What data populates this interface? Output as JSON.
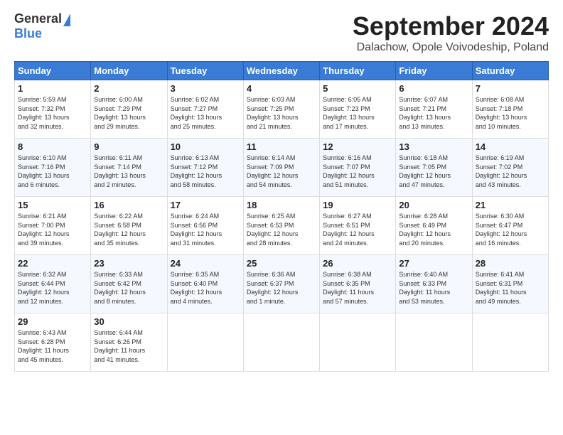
{
  "logo": {
    "general": "General",
    "blue": "Blue"
  },
  "title": "September 2024",
  "location": "Dalachow, Opole Voivodeship, Poland",
  "headers": [
    "Sunday",
    "Monday",
    "Tuesday",
    "Wednesday",
    "Thursday",
    "Friday",
    "Saturday"
  ],
  "weeks": [
    [
      {
        "day": "1",
        "lines": [
          "Sunrise: 5:59 AM",
          "Sunset: 7:32 PM",
          "Daylight: 13 hours",
          "and 32 minutes."
        ]
      },
      {
        "day": "2",
        "lines": [
          "Sunrise: 6:00 AM",
          "Sunset: 7:29 PM",
          "Daylight: 13 hours",
          "and 29 minutes."
        ]
      },
      {
        "day": "3",
        "lines": [
          "Sunrise: 6:02 AM",
          "Sunset: 7:27 PM",
          "Daylight: 13 hours",
          "and 25 minutes."
        ]
      },
      {
        "day": "4",
        "lines": [
          "Sunrise: 6:03 AM",
          "Sunset: 7:25 PM",
          "Daylight: 13 hours",
          "and 21 minutes."
        ]
      },
      {
        "day": "5",
        "lines": [
          "Sunrise: 6:05 AM",
          "Sunset: 7:23 PM",
          "Daylight: 13 hours",
          "and 17 minutes."
        ]
      },
      {
        "day": "6",
        "lines": [
          "Sunrise: 6:07 AM",
          "Sunset: 7:21 PM",
          "Daylight: 13 hours",
          "and 13 minutes."
        ]
      },
      {
        "day": "7",
        "lines": [
          "Sunrise: 6:08 AM",
          "Sunset: 7:18 PM",
          "Daylight: 13 hours",
          "and 10 minutes."
        ]
      }
    ],
    [
      {
        "day": "8",
        "lines": [
          "Sunrise: 6:10 AM",
          "Sunset: 7:16 PM",
          "Daylight: 13 hours",
          "and 6 minutes."
        ]
      },
      {
        "day": "9",
        "lines": [
          "Sunrise: 6:11 AM",
          "Sunset: 7:14 PM",
          "Daylight: 13 hours",
          "and 2 minutes."
        ]
      },
      {
        "day": "10",
        "lines": [
          "Sunrise: 6:13 AM",
          "Sunset: 7:12 PM",
          "Daylight: 12 hours",
          "and 58 minutes."
        ]
      },
      {
        "day": "11",
        "lines": [
          "Sunrise: 6:14 AM",
          "Sunset: 7:09 PM",
          "Daylight: 12 hours",
          "and 54 minutes."
        ]
      },
      {
        "day": "12",
        "lines": [
          "Sunrise: 6:16 AM",
          "Sunset: 7:07 PM",
          "Daylight: 12 hours",
          "and 51 minutes."
        ]
      },
      {
        "day": "13",
        "lines": [
          "Sunrise: 6:18 AM",
          "Sunset: 7:05 PM",
          "Daylight: 12 hours",
          "and 47 minutes."
        ]
      },
      {
        "day": "14",
        "lines": [
          "Sunrise: 6:19 AM",
          "Sunset: 7:02 PM",
          "Daylight: 12 hours",
          "and 43 minutes."
        ]
      }
    ],
    [
      {
        "day": "15",
        "lines": [
          "Sunrise: 6:21 AM",
          "Sunset: 7:00 PM",
          "Daylight: 12 hours",
          "and 39 minutes."
        ]
      },
      {
        "day": "16",
        "lines": [
          "Sunrise: 6:22 AM",
          "Sunset: 6:58 PM",
          "Daylight: 12 hours",
          "and 35 minutes."
        ]
      },
      {
        "day": "17",
        "lines": [
          "Sunrise: 6:24 AM",
          "Sunset: 6:56 PM",
          "Daylight: 12 hours",
          "and 31 minutes."
        ]
      },
      {
        "day": "18",
        "lines": [
          "Sunrise: 6:25 AM",
          "Sunset: 6:53 PM",
          "Daylight: 12 hours",
          "and 28 minutes."
        ]
      },
      {
        "day": "19",
        "lines": [
          "Sunrise: 6:27 AM",
          "Sunset: 6:51 PM",
          "Daylight: 12 hours",
          "and 24 minutes."
        ]
      },
      {
        "day": "20",
        "lines": [
          "Sunrise: 6:28 AM",
          "Sunset: 6:49 PM",
          "Daylight: 12 hours",
          "and 20 minutes."
        ]
      },
      {
        "day": "21",
        "lines": [
          "Sunrise: 6:30 AM",
          "Sunset: 6:47 PM",
          "Daylight: 12 hours",
          "and 16 minutes."
        ]
      }
    ],
    [
      {
        "day": "22",
        "lines": [
          "Sunrise: 6:32 AM",
          "Sunset: 6:44 PM",
          "Daylight: 12 hours",
          "and 12 minutes."
        ]
      },
      {
        "day": "23",
        "lines": [
          "Sunrise: 6:33 AM",
          "Sunset: 6:42 PM",
          "Daylight: 12 hours",
          "and 8 minutes."
        ]
      },
      {
        "day": "24",
        "lines": [
          "Sunrise: 6:35 AM",
          "Sunset: 6:40 PM",
          "Daylight: 12 hours",
          "and 4 minutes."
        ]
      },
      {
        "day": "25",
        "lines": [
          "Sunrise: 6:36 AM",
          "Sunset: 6:37 PM",
          "Daylight: 12 hours",
          "and 1 minute."
        ]
      },
      {
        "day": "26",
        "lines": [
          "Sunrise: 6:38 AM",
          "Sunset: 6:35 PM",
          "Daylight: 11 hours",
          "and 57 minutes."
        ]
      },
      {
        "day": "27",
        "lines": [
          "Sunrise: 6:40 AM",
          "Sunset: 6:33 PM",
          "Daylight: 11 hours",
          "and 53 minutes."
        ]
      },
      {
        "day": "28",
        "lines": [
          "Sunrise: 6:41 AM",
          "Sunset: 6:31 PM",
          "Daylight: 11 hours",
          "and 49 minutes."
        ]
      }
    ],
    [
      {
        "day": "29",
        "lines": [
          "Sunrise: 6:43 AM",
          "Sunset: 6:28 PM",
          "Daylight: 11 hours",
          "and 45 minutes."
        ]
      },
      {
        "day": "30",
        "lines": [
          "Sunrise: 6:44 AM",
          "Sunset: 6:26 PM",
          "Daylight: 11 hours",
          "and 41 minutes."
        ]
      },
      {
        "day": "",
        "lines": []
      },
      {
        "day": "",
        "lines": []
      },
      {
        "day": "",
        "lines": []
      },
      {
        "day": "",
        "lines": []
      },
      {
        "day": "",
        "lines": []
      }
    ]
  ]
}
